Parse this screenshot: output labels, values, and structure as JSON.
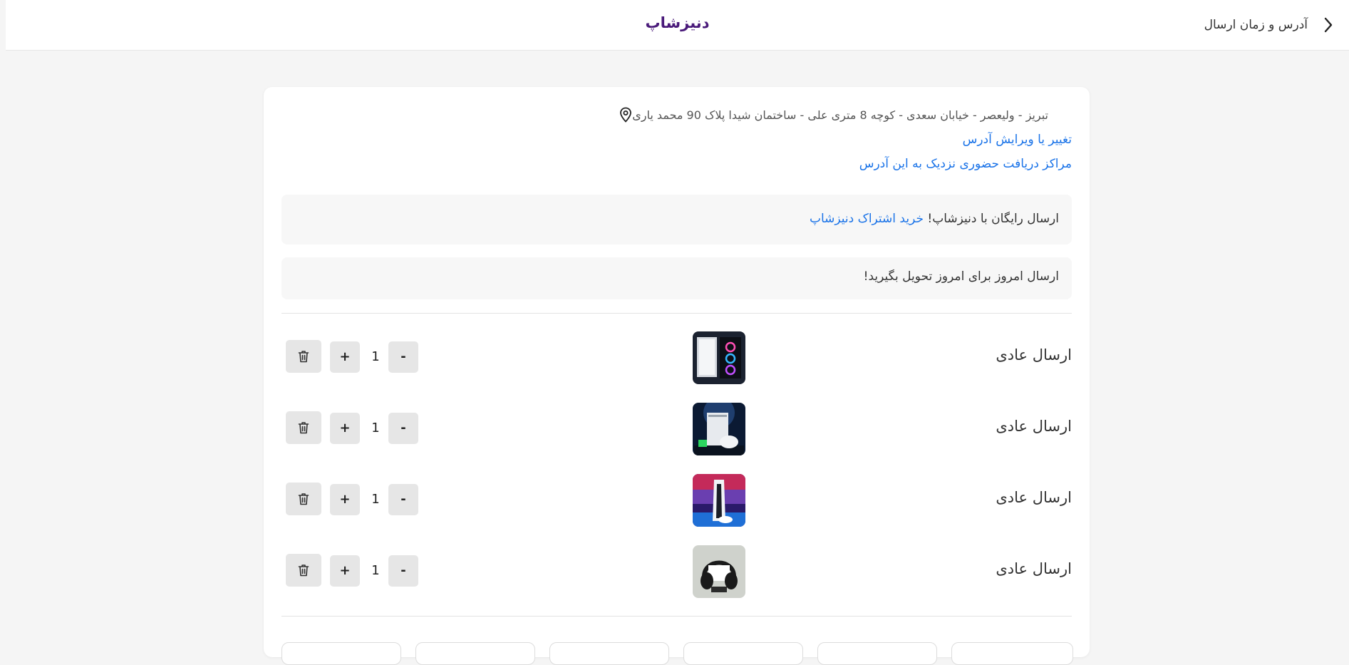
{
  "header": {
    "brand": "دنیزشاپ",
    "back_title": "آدرس و زمان ارسال"
  },
  "address": {
    "text": "تبریز - ولیعصر - خیابان سعدی - کوچه 8 متری علی - ساختمان شیدا پلاک 90 محمد یاری",
    "edit_link": "تغییر یا ویرایش آدرس",
    "pickup_link": "مراکز دریافت حضوری نزدیک به این آدرس"
  },
  "promos": {
    "free_shipping": "ارسال رایگان با دنیزشاپ!",
    "subscription_link": "خرید اشتراک دنیزشاپ",
    "today_delivery": "ارسال امروز برای امروز تحویل بگیرید!"
  },
  "items": [
    {
      "label": "ارسال عادی",
      "quantity": "1",
      "plus": "+",
      "minus": "-",
      "image": "gaming-pc-product"
    },
    {
      "label": "ارسال عادی",
      "quantity": "1",
      "plus": "+",
      "minus": "-",
      "image": "xbox-console-product"
    },
    {
      "label": "ارسال عادی",
      "quantity": "1",
      "plus": "+",
      "minus": "-",
      "image": "playstation-console-product"
    },
    {
      "label": "ارسال عادی",
      "quantity": "1",
      "plus": "+",
      "minus": "-",
      "image": "headphones-product"
    }
  ],
  "colors": {
    "brand": "#4a1a7a",
    "link": "#1a73e8",
    "background": "#f5f5f5",
    "button": "#e6e6e6"
  }
}
